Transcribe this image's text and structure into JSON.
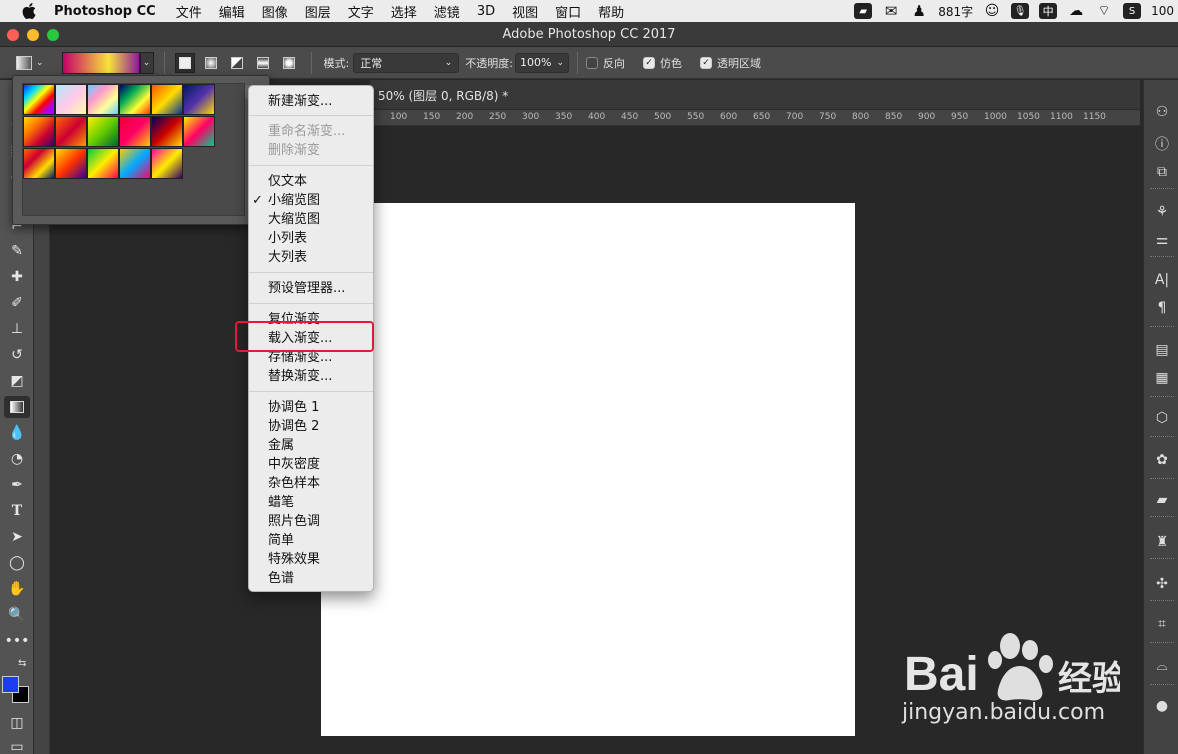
{
  "menubar": {
    "app_name": "Photoshop CC",
    "items": [
      "文件",
      "编辑",
      "图像",
      "图层",
      "文字",
      "选择",
      "滤镜",
      "3D",
      "视图",
      "窗口",
      "帮助"
    ],
    "char_count": "881字",
    "battery": "100"
  },
  "window": {
    "title": "Adobe Photoshop CC 2017"
  },
  "options": {
    "mode_label": "模式:",
    "mode_value": "正常",
    "opacity_label": "不透明度:",
    "opacity_value": "100%",
    "reverse_label": "反向",
    "dither_label": "仿色",
    "transparency_label": "透明区域"
  },
  "document": {
    "tab_title": "50% (图层 0, RGB/8) *",
    "ruler_ticks": [
      "100",
      "150",
      "200",
      "250",
      "300",
      "350",
      "400",
      "450",
      "500",
      "550",
      "600",
      "650",
      "700",
      "750",
      "800",
      "850",
      "900",
      "950",
      "1000",
      "1050",
      "1100",
      "1150"
    ]
  },
  "context_menu": {
    "new_gradient": "新建渐变...",
    "rename_gradient": "重命名渐变...",
    "delete_gradient": "删除渐变",
    "text_only": "仅文本",
    "small_thumbnail": "小缩览图",
    "large_thumbnail": "大缩览图",
    "small_list": "小列表",
    "large_list": "大列表",
    "preset_manager": "预设管理器...",
    "reset_gradients": "复位渐变...",
    "load_gradients": "载入渐变...",
    "save_gradients": "存储渐变...",
    "replace_gradients": "替换渐变...",
    "presets": [
      "协调色 1",
      "协调色 2",
      "金属",
      "中灰密度",
      "杂色样本",
      "蜡笔",
      "照片色调",
      "简单",
      "特殊效果",
      "色谱"
    ]
  },
  "watermark": {
    "brand_text": "Bai 经验",
    "url": "jingyan.baidu.com"
  },
  "colors": {
    "foreground": "#1e3cf0",
    "background": "#000000",
    "highlight": "#e5173a"
  }
}
